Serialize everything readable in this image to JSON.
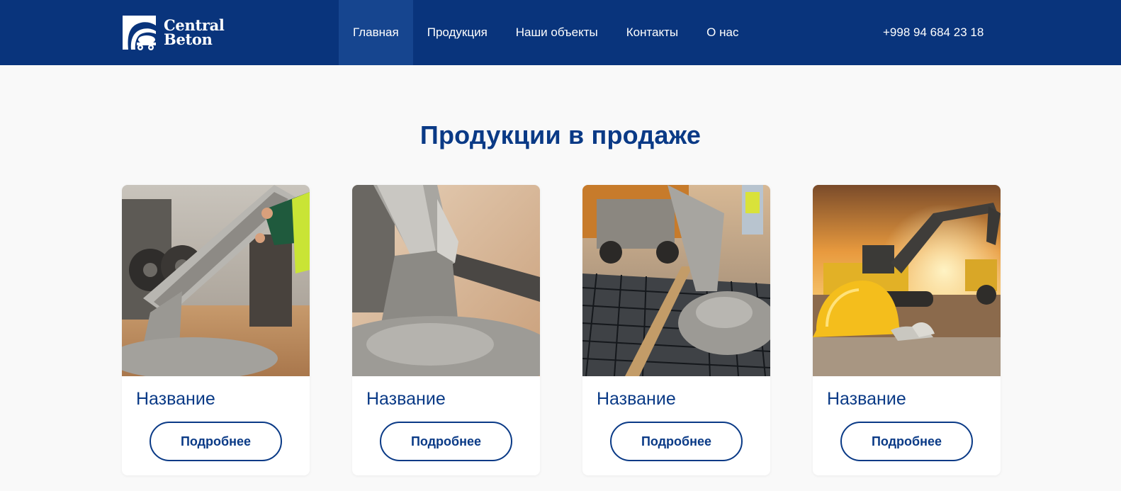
{
  "brand": {
    "line1": "Central",
    "line2": "Beton",
    "logo_icon": "concrete-mixer-truck-icon",
    "colors": {
      "primary": "#09347c",
      "nav_active": "#16458f",
      "text_accent": "#0a3a86",
      "background": "#f9f9f9"
    }
  },
  "nav": {
    "items": [
      {
        "label": "Главная",
        "active": true
      },
      {
        "label": "Продукция",
        "active": false
      },
      {
        "label": "Наши объекты",
        "active": false
      },
      {
        "label": "Контакты",
        "active": false
      },
      {
        "label": "О нас",
        "active": false
      }
    ],
    "phone": "+998 94 684 23 18"
  },
  "products": {
    "title": "Продукции в продаже",
    "cards": [
      {
        "image": "concrete-chute-pouring-photo",
        "title": "Название",
        "button": "Подробнее"
      },
      {
        "image": "concrete-pour-closeup-photo",
        "title": "Название",
        "button": "Подробнее"
      },
      {
        "image": "concrete-rebar-mesh-photo",
        "title": "Название",
        "button": "Подробнее"
      },
      {
        "image": "excavator-hardhat-sunset-photo",
        "title": "Название",
        "button": "Подробнее"
      }
    ]
  }
}
